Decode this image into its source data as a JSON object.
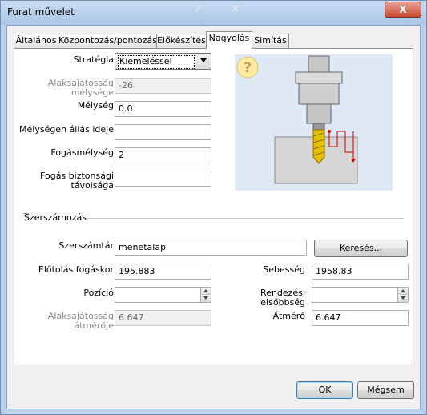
{
  "window": {
    "title": "Furat művelet",
    "close_label": "X"
  },
  "tabs": [
    {
      "label": "Általános"
    },
    {
      "label": "Központozás/pontozás"
    },
    {
      "label": "Előkészítés"
    },
    {
      "label": "Nagyolás"
    },
    {
      "label": "Simítás"
    }
  ],
  "form": {
    "strategy_label": "Stratégia",
    "strategy_value": "Kiemeléssel",
    "sub_depth_label": "Alaksajátosság mélysége",
    "sub_depth_value": "-26",
    "depth_label": "Mélység",
    "depth_value": "0.0",
    "dwell_label": "Mélységen állás ideje",
    "dwell_value": "",
    "step_label": "Fogásmélység",
    "step_value": "2",
    "safety_label": "Fogás biztonsági távolsága",
    "safety_value": ""
  },
  "tooling": {
    "section_label": "Szerszámozás",
    "library_label": "Szerszámtár",
    "library_value": "menetalap",
    "search_button": "Keresés...",
    "feed_label": "Előtolás fogáskor",
    "feed_value": "195.883",
    "speed_label": "Sebesség",
    "speed_value": "1958.83",
    "position_label": "Pozíció",
    "position_value": "",
    "priority_label": "Rendezési elsőbbség",
    "priority_value": "",
    "feature_diam_label": "Alaksajátosság átmérője",
    "feature_diam_value": "6.647",
    "diameter_label": "Átmérő",
    "diameter_value": "6.647"
  },
  "footer": {
    "ok_label": "OK",
    "cancel_label": "Mégsem"
  },
  "help_glyph": "?",
  "colors": {
    "title_bg": "#b9d1ea",
    "close": "#c74a33",
    "drill_gold": "#e6c000",
    "path_red": "#cc0000"
  }
}
